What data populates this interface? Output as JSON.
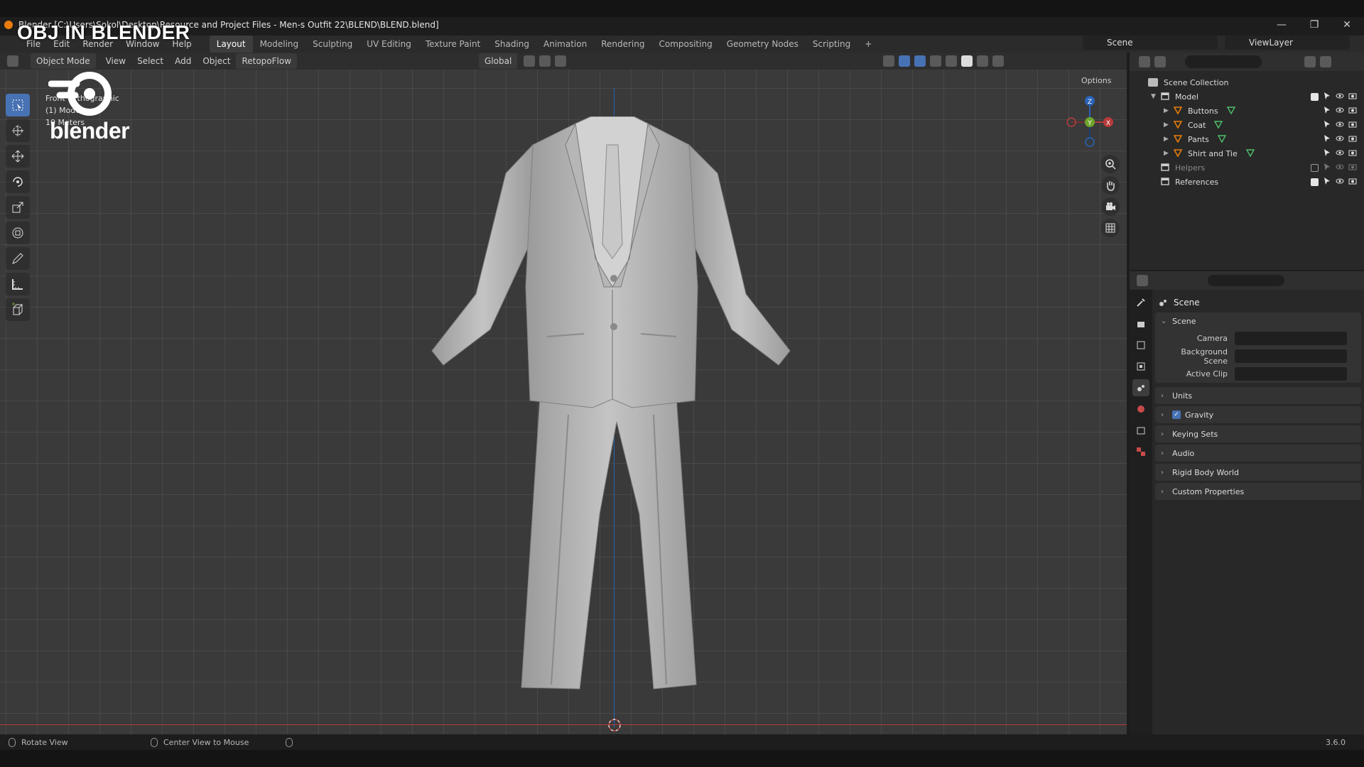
{
  "window": {
    "title": "Blender [C:\\Users\\Sokol\\Desktop\\Resource and Project Files - Men-s Outfit 22\\BLEND\\BLEND.blend]",
    "controls": [
      "—",
      "❐",
      "✕"
    ]
  },
  "overlay": {
    "title": "OBJ IN BLENDER",
    "logo_text": "blender"
  },
  "menubar": {
    "menus": [
      "File",
      "Edit",
      "Render",
      "Window",
      "Help"
    ],
    "workspaces": [
      "Layout",
      "Modeling",
      "Sculpting",
      "UV Editing",
      "Texture Paint",
      "Shading",
      "Animation",
      "Rendering",
      "Compositing",
      "Geometry Nodes",
      "Scripting"
    ],
    "active_workspace": "Layout",
    "add_tab": "+",
    "scene": "Scene",
    "view_layer": "ViewLayer"
  },
  "viewport": {
    "mode": "Object Mode",
    "menus": [
      "View",
      "Select",
      "Add",
      "Object",
      "RetopoFlow"
    ],
    "transform_orientation": "Global",
    "options_label": "Options",
    "info": [
      "Front Orthographic",
      "(1) Model",
      "10 Meters"
    ],
    "gizmo_axes": {
      "z": "Z",
      "y": "Y",
      "x": "X"
    }
  },
  "toolbar": {
    "tools": [
      "select-box",
      "cursor",
      "move",
      "rotate",
      "scale",
      "transform",
      "annotate",
      "measure",
      "add-cube"
    ],
    "active": "select-box"
  },
  "outliner": {
    "root": "Scene Collection",
    "items": [
      {
        "label": "Model",
        "level": 1,
        "type": "collection",
        "checked": true,
        "dim": false
      },
      {
        "label": "Buttons",
        "level": 2,
        "type": "mesh",
        "checked": null,
        "dim": false
      },
      {
        "label": "Coat",
        "level": 2,
        "type": "mesh",
        "checked": null,
        "dim": false
      },
      {
        "label": "Pants",
        "level": 2,
        "type": "mesh",
        "checked": null,
        "dim": false
      },
      {
        "label": "Shirt and Tie",
        "level": 2,
        "type": "mesh",
        "checked": null,
        "dim": false
      },
      {
        "label": "Helpers",
        "level": 1,
        "type": "collection",
        "checked": false,
        "dim": true
      },
      {
        "label": "References",
        "level": 1,
        "type": "collection",
        "checked": true,
        "dim": false
      }
    ]
  },
  "properties": {
    "context_title": "Scene",
    "scene_panel": {
      "label": "Scene",
      "fields": [
        {
          "label": "Camera",
          "value": ""
        },
        {
          "label": "Background Scene",
          "value": ""
        },
        {
          "label": "Active Clip",
          "value": ""
        }
      ]
    },
    "panels": [
      {
        "label": "Units",
        "checkbox": false
      },
      {
        "label": "Gravity",
        "checkbox": true
      },
      {
        "label": "Keying Sets",
        "checkbox": false
      },
      {
        "label": "Audio",
        "checkbox": false
      },
      {
        "label": "Rigid Body World",
        "checkbox": false
      },
      {
        "label": "Custom Properties",
        "checkbox": false
      }
    ]
  },
  "statusbar": {
    "hints": [
      "Rotate View",
      "Center View to Mouse"
    ],
    "version": "3.6.0"
  },
  "colors": {
    "accent": "#4772b3",
    "object_orange": "#e87d0d",
    "axis_x": "#b83a3a",
    "axis_y": "#6ea52a",
    "axis_z": "#2a62b8"
  }
}
